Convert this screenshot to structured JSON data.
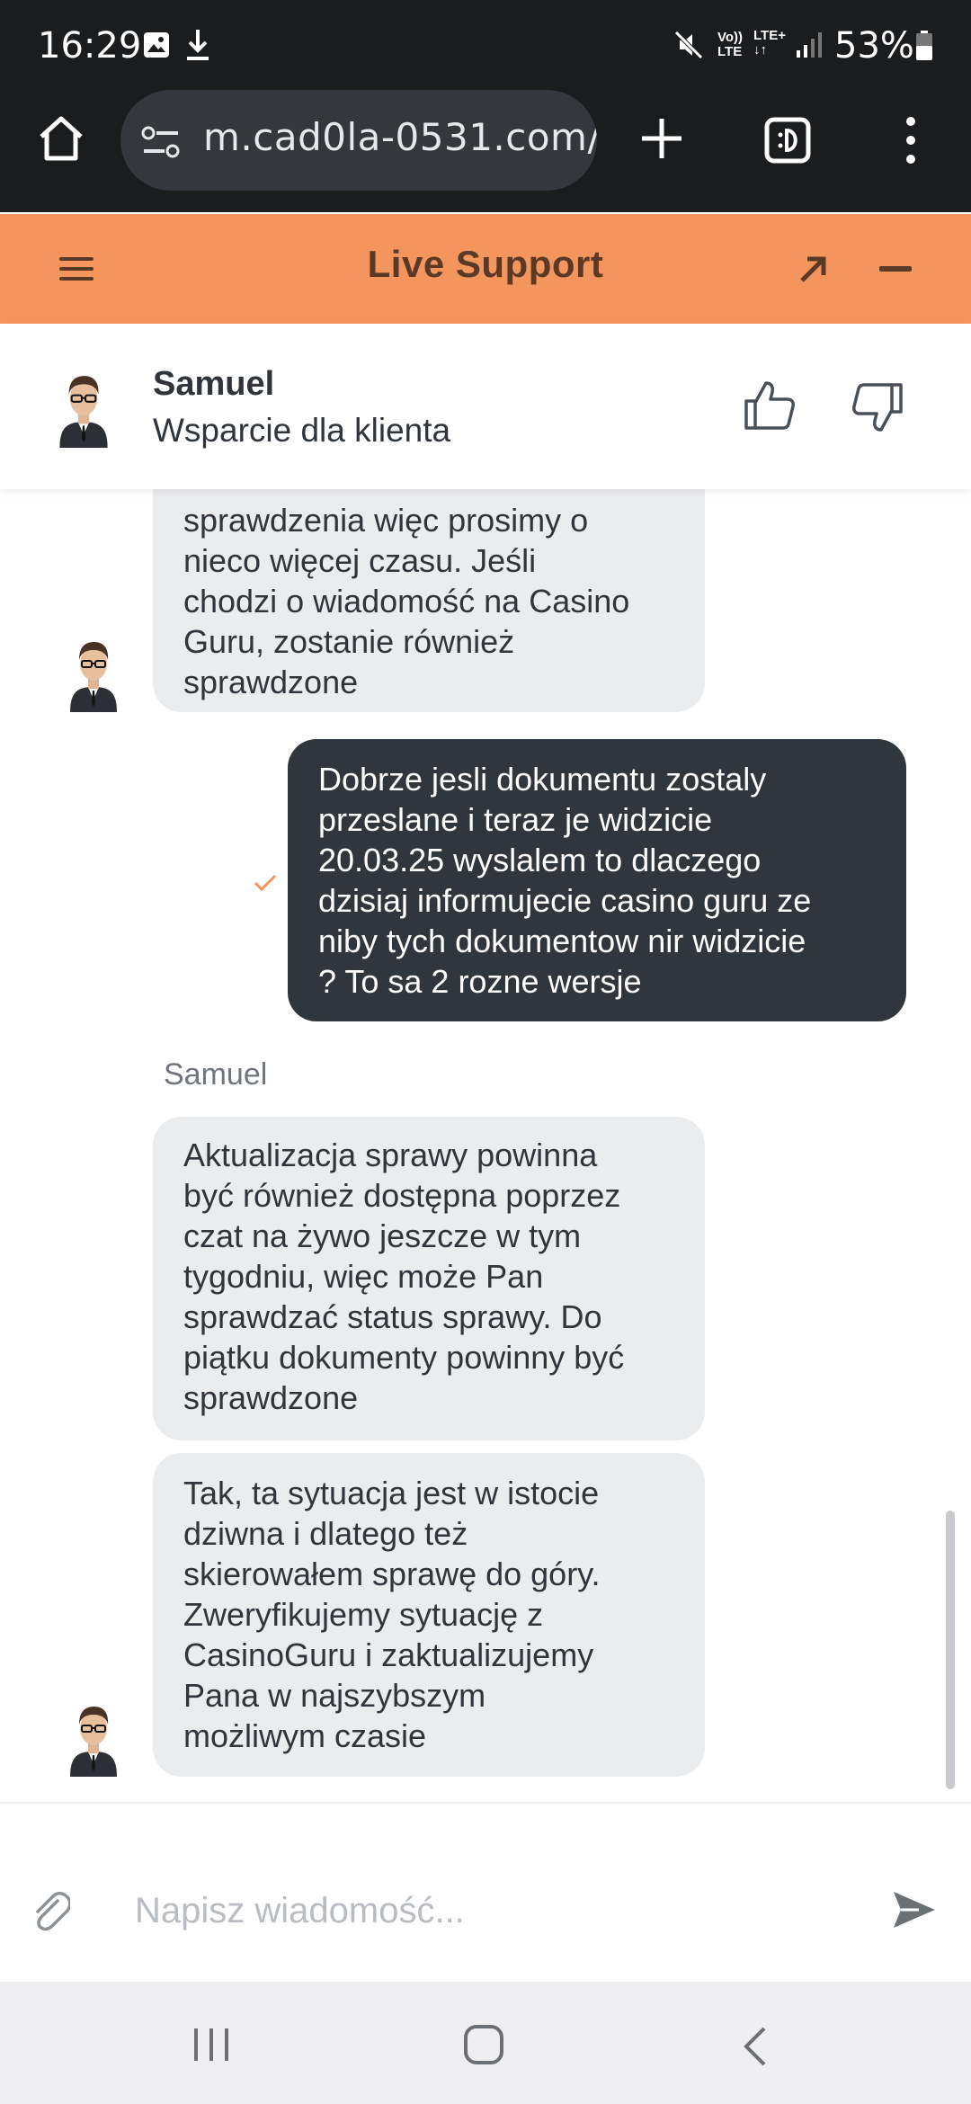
{
  "status_bar": {
    "time": "16:29",
    "volte_line1": "Vo))",
    "volte_line2": "LTE",
    "lte_line1": "LTE+",
    "lte_line2": "↓↑",
    "battery": "53%"
  },
  "browser": {
    "url": "m.cad0la-0531.com/",
    "icons": [
      "home-icon",
      "site-settings-icon",
      "plus-icon",
      "tab-switcher-icon",
      "more-vert-icon"
    ]
  },
  "support": {
    "title": "Live Support",
    "accent_color": "#f5955e",
    "icons": [
      "hamburger-icon",
      "expand-arrow-icon",
      "minimize-icon"
    ]
  },
  "agent": {
    "name": "Samuel",
    "role": "Wsparcie dla klienta",
    "icons": [
      "thumbs-up-icon",
      "thumbs-down-icon"
    ]
  },
  "messages": [
    {
      "from": "agent",
      "lines": [
        "sprawdzenia więc prosimy o",
        "nieco więcej czasu. Jeśli",
        "chodzi o wiadomość na Casino",
        "Guru, zostanie również",
        "sprawdzone"
      ]
    },
    {
      "from": "user",
      "read": true,
      "lines": [
        "Dobrze jesli dokumentu zostaly",
        "przeslane i teraz je widzicie",
        "20.03.25 wyslalem to dlaczego",
        "dzisiaj informujecie casino guru ze",
        "niby tych dokumentow nir widzicie",
        "? To sa 2 rozne wersje"
      ]
    },
    {
      "from": "agent",
      "sender": "Samuel",
      "lines": [
        "Aktualizacja sprawy powinna",
        "być również dostępna poprzez",
        "czat na żywo jeszcze w tym",
        "tygodniu, więc może Pan",
        "sprawdzać status sprawy. Do",
        "piątku dokumenty powinny być",
        "sprawdzone"
      ]
    },
    {
      "from": "agent",
      "lines": [
        "Tak, ta sytuacja jest w istocie",
        "dziwna i dlatego też",
        "skierowałem sprawę do góry.",
        "Zweryfikujemy sytuację z",
        "CasinoGuru i zaktualizujemy",
        "Pana w najszybszym",
        "możliwym czasie"
      ]
    }
  ],
  "composer": {
    "placeholder": "Napisz wiadomość...",
    "icons": [
      "paperclip-icon",
      "send-icon"
    ]
  },
  "nav": {
    "icons": [
      "recents-icon",
      "home-circle-icon",
      "back-icon"
    ]
  }
}
